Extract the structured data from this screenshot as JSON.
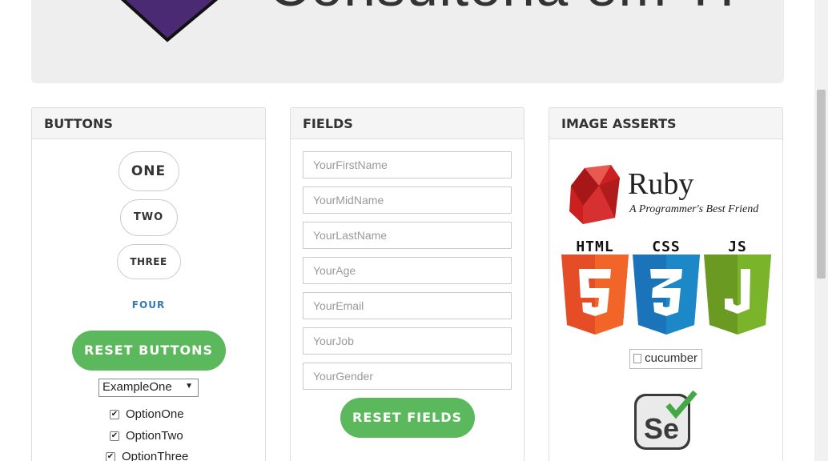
{
  "header": {
    "title": "Consultoria em TI"
  },
  "buttons_panel": {
    "heading": "BUTTONS",
    "one": "ONE",
    "two": "TWO",
    "three": "THREE",
    "four": "FOUR",
    "reset": "RESET BUTTONS",
    "select_value": "ExampleOne",
    "options": [
      "OptionOne",
      "OptionTwo",
      "OptionThree"
    ]
  },
  "fields_panel": {
    "heading": "FIELDS",
    "placeholders": [
      "YourFirstName",
      "YourMidName",
      "YourLastName",
      "YourAge",
      "YourEmail",
      "YourJob",
      "YourGender"
    ],
    "reset": "RESET FIELDS"
  },
  "images_panel": {
    "heading": "IMAGE ASSERTS",
    "ruby_word": "Ruby",
    "ruby_tagline": "A Programmer's Best Friend",
    "html_label": "HTML",
    "css_label": "CSS",
    "js_label": "JS",
    "cucumber_alt": "cucumber",
    "colors": {
      "html": "#e44d26",
      "css": "#1b73ba",
      "js": "#7ab42a",
      "ruby": "#cc1f1f",
      "button": "#5cb85c",
      "link": "#337ab7"
    }
  }
}
